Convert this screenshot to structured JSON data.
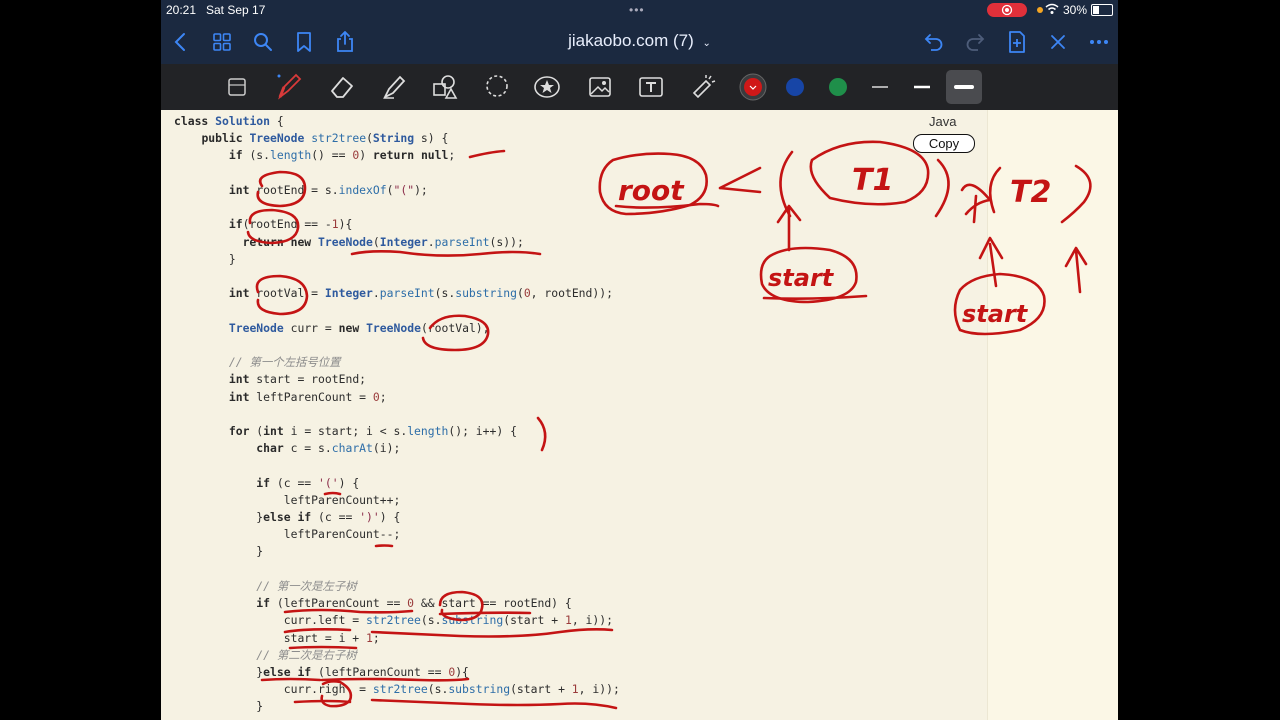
{
  "status": {
    "time": "20:21",
    "date": "Sat Sep 17",
    "battery": "30%"
  },
  "nav": {
    "title": "jiakaobo.com (7)"
  },
  "icons": {
    "back": "chevron-left-icon",
    "grid": "grid-icon",
    "search": "search-icon",
    "bookmark": "bookmark-icon",
    "share": "share-icon",
    "undo": "undo-icon",
    "redo": "redo-icon",
    "add_page": "add-page-icon",
    "close": "close-icon",
    "more": "more-icon"
  },
  "toolbar": {
    "tools": [
      "page-select-tool",
      "pen-tool",
      "eraser-tool",
      "highlighter-tool",
      "shapes-tool",
      "lasso-tool",
      "sticker-tool",
      "image-tool",
      "text-tool",
      "laser-tool"
    ],
    "colors": [
      "#d01818",
      "#1745a6",
      "#1f8f4a"
    ],
    "selected_color": "#d01818"
  },
  "code_block": {
    "language": "Java",
    "copy_label": "Copy",
    "lines": [
      "class Solution {",
      "    public TreeNode str2tree(String s) {",
      "        if (s.length() == 0) return null;",
      "",
      "        int rootEnd = s.indexOf(\"(\");",
      "",
      "        if(rootEnd == -1){",
      "          return new TreeNode(Integer.parseInt(s));",
      "        }",
      "",
      "        int rootVal = Integer.parseInt(s.substring(0, rootEnd));",
      "",
      "        TreeNode curr = new TreeNode(rootVal);",
      "",
      "        // 第一个左括号位置",
      "        int start = rootEnd;",
      "        int leftParenCount = 0;",
      "",
      "        for (int i = start; i < s.length(); i++) {",
      "            char c = s.charAt(i);",
      "",
      "            if (c == '(') {",
      "                leftParenCount++;",
      "            }else if (c == ')') {",
      "                leftParenCount--;",
      "            }",
      "",
      "            // 第一次是左子树",
      "            if (leftParenCount == 0 && start == rootEnd) {",
      "                curr.left = str2tree(s.substring(start + 1, i));",
      "                start = i + 1;",
      "            // 第二次是右子树",
      "            }else if (leftParenCount == 0){",
      "                curr.righ  = str2tree(s.substring(start + 1, i));",
      "            }"
    ]
  },
  "handwriting": {
    "root_label": "root",
    "t1_label": "T1",
    "t2_label": "T2",
    "start_label_1": "start",
    "start_label_2": "start"
  }
}
